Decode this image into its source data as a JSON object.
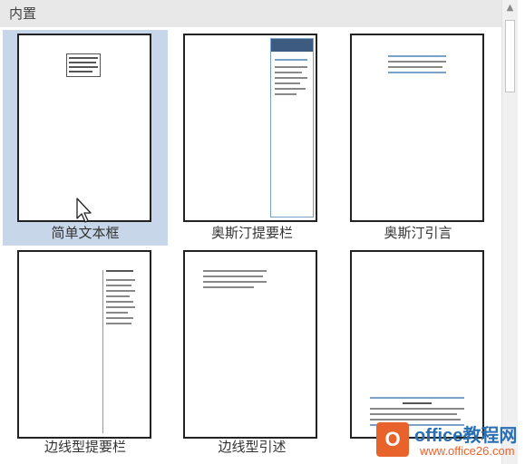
{
  "gallery": {
    "section_label": "内置",
    "items": [
      {
        "label": "简单文本框"
      },
      {
        "label": "奥斯汀提要栏"
      },
      {
        "label": "奥斯汀引言"
      },
      {
        "label": "边线型提要栏"
      },
      {
        "label": "边线型引述"
      },
      {
        "label": ""
      }
    ],
    "selected_index": 0
  },
  "scrollbar": {
    "up_arrow": "▲"
  },
  "watermark": {
    "logo_letter": "O",
    "title": "office教程网",
    "url": "www.office26.com"
  },
  "colors": {
    "selection": "#c7d6e8",
    "header": "#e8e8e8",
    "accent_blue": "#3d5a80",
    "logo_orange": "#e8622c"
  }
}
